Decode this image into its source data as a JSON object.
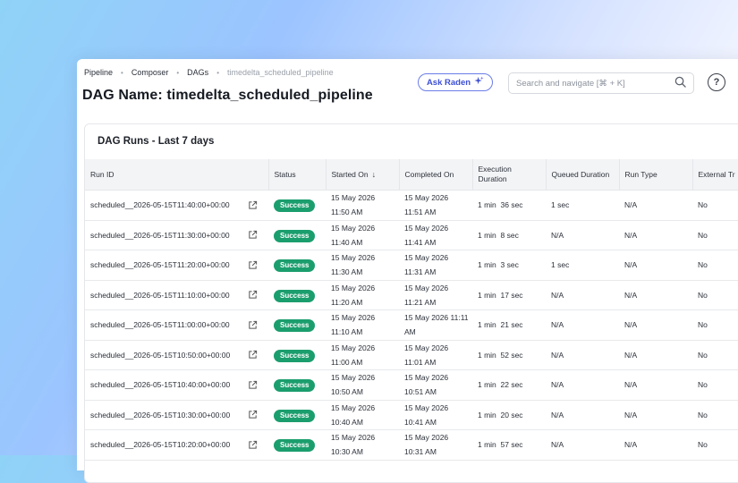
{
  "breadcrumb": {
    "items": [
      "Pipeline",
      "Composer",
      "DAGs"
    ],
    "current": "timedelta_scheduled_pipeline",
    "separator": "•"
  },
  "page_title": "DAG Name: timedelta_scheduled_pipeline",
  "ask_button": {
    "label": "Ask Raden",
    "icon": "sparkle-icon"
  },
  "search": {
    "placeholder": "Search and navigate [⌘ + K]",
    "icon": "search-icon"
  },
  "help": {
    "label": "?",
    "icon": "help-icon"
  },
  "card": {
    "title": "DAG Runs - Last 7 days"
  },
  "table": {
    "headers": {
      "run_id": "Run ID",
      "status": "Status",
      "started_on": "Started On",
      "completed_on": "Completed On",
      "exec_duration_1": "Execution",
      "exec_duration_2": "Duration",
      "queued_duration": "Queued Duration",
      "run_type": "Run Type",
      "external": "External Tr"
    },
    "sort_icon": "arrow-down-icon",
    "rows": [
      {
        "run_id": "scheduled__2026-05-15T11:40:00+00:00",
        "status": "Success",
        "started_1": "15 May 2026",
        "started_2": "11:50 AM",
        "completed_1": "15 May 2026",
        "completed_2": "11:51 AM",
        "duration": "1 min  36 sec",
        "queued": "1 sec",
        "run_type": "N/A",
        "external": "No"
      },
      {
        "run_id": "scheduled__2026-05-15T11:30:00+00:00",
        "status": "Success",
        "started_1": "15 May 2026",
        "started_2": "11:40 AM",
        "completed_1": "15 May 2026",
        "completed_2": "11:41 AM",
        "duration": "1 min  8 sec",
        "queued": "N/A",
        "run_type": "N/A",
        "external": "No"
      },
      {
        "run_id": "scheduled__2026-05-15T11:20:00+00:00",
        "status": "Success",
        "started_1": "15 May 2026",
        "started_2": "11:30 AM",
        "completed_1": "15 May 2026",
        "completed_2": "11:31 AM",
        "duration": "1 min  3 sec",
        "queued": "1 sec",
        "run_type": "N/A",
        "external": "No"
      },
      {
        "run_id": "scheduled__2026-05-15T11:10:00+00:00",
        "status": "Success",
        "started_1": "15 May 2026",
        "started_2": "11:20 AM",
        "completed_1": "15 May 2026",
        "completed_2": "11:21 AM",
        "duration": "1 min  17 sec",
        "queued": "N/A",
        "run_type": "N/A",
        "external": "No"
      },
      {
        "run_id": "scheduled__2026-05-15T11:00:00+00:00",
        "status": "Success",
        "started_1": "15 May 2026",
        "started_2": "11:10 AM",
        "completed_1": "15 May 2026 11:11",
        "completed_2": "AM",
        "duration": "1 min  21 sec",
        "queued": "N/A",
        "run_type": "N/A",
        "external": "No"
      },
      {
        "run_id": "scheduled__2026-05-15T10:50:00+00:00",
        "status": "Success",
        "started_1": "15 May 2026",
        "started_2": "11:00 AM",
        "completed_1": "15 May 2026",
        "completed_2": "11:01 AM",
        "duration": "1 min  52 sec",
        "queued": "N/A",
        "run_type": "N/A",
        "external": "No"
      },
      {
        "run_id": "scheduled__2026-05-15T10:40:00+00:00",
        "status": "Success",
        "started_1": "15 May 2026",
        "started_2": "10:50 AM",
        "completed_1": "15 May 2026",
        "completed_2": "10:51 AM",
        "duration": "1 min  22 sec",
        "queued": "N/A",
        "run_type": "N/A",
        "external": "No"
      },
      {
        "run_id": "scheduled__2026-05-15T10:30:00+00:00",
        "status": "Success",
        "started_1": "15 May 2026",
        "started_2": "10:40 AM",
        "completed_1": "15 May 2026",
        "completed_2": "10:41 AM",
        "duration": "1 min  20 sec",
        "queued": "N/A",
        "run_type": "N/A",
        "external": "No"
      },
      {
        "run_id": "scheduled__2026-05-15T10:20:00+00:00",
        "status": "Success",
        "started_1": "15 May 2026",
        "started_2": "10:30 AM",
        "completed_1": "15 May 2026",
        "completed_2": "10:31 AM",
        "duration": "1 min  57 sec",
        "queued": "N/A",
        "run_type": "N/A",
        "external": "No"
      }
    ]
  },
  "colors": {
    "success_badge": "#1b9e6e",
    "accent": "#3d4fd4"
  }
}
